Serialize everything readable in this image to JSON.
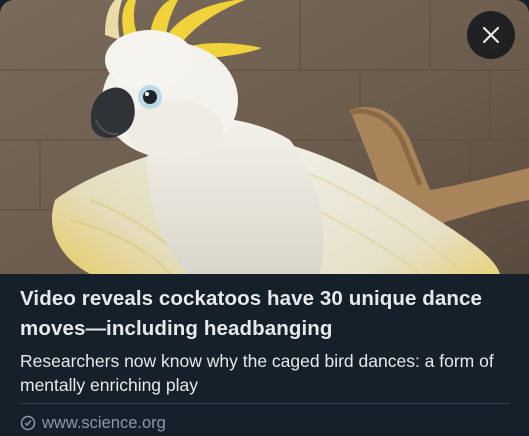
{
  "card": {
    "image_alt_icon": "cockatoo-photo",
    "close_icon": "close-icon",
    "headline": "Video reveals cockatoos have 30 unique dance moves—including headbanging",
    "description": "Researchers now know why the caged bird dances: a form of mentally enriching play",
    "source": {
      "icon": "link-icon",
      "domain": "www.science.org"
    }
  },
  "colors": {
    "background": "#15202b",
    "text_primary": "#e7e9ea",
    "text_secondary": "#8b98a5",
    "close_button_bg": "#0f1419"
  }
}
